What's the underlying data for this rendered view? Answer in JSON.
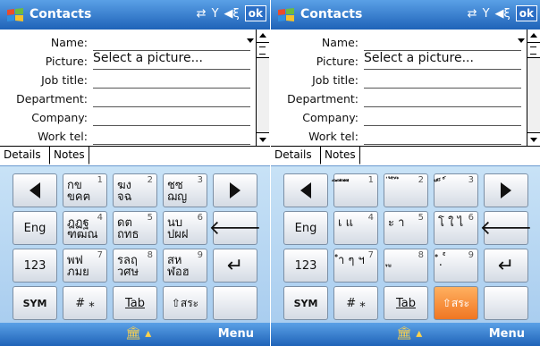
{
  "screens": [
    {
      "title": "Contacts",
      "ok_label": "ok",
      "fields": [
        {
          "label": "Name:",
          "value": "",
          "dropdown": true
        },
        {
          "label": "Picture:",
          "value": "Select a picture..."
        },
        {
          "label": "Job title:",
          "value": ""
        },
        {
          "label": "Department:",
          "value": ""
        },
        {
          "label": "Company:",
          "value": ""
        },
        {
          "label": "Work tel:",
          "value": ""
        }
      ],
      "tabs": [
        "Details",
        "Notes"
      ],
      "keys_row1": [
        {
          "glyph": "กข\nขคฅ",
          "num": "1"
        },
        {
          "glyph": "ฆง\nจฉ",
          "num": "2"
        },
        {
          "glyph": "ชซ\nฌญ",
          "num": "3"
        }
      ],
      "keys_row2": [
        {
          "glyph": "ฎฏฐ\nฑฒณ",
          "num": "4"
        },
        {
          "glyph": "ดต\nถทธ",
          "num": "5"
        },
        {
          "glyph": "นบ\nปผฝ",
          "num": "6"
        }
      ],
      "keys_row3": [
        {
          "glyph": "พฟ\nภมย",
          "num": "7"
        },
        {
          "glyph": "รลฤ\nวศษ",
          "num": "8"
        },
        {
          "glyph": "สห\nฬอฮ",
          "num": "9"
        }
      ],
      "key_eng": "Eng",
      "key_123": "123",
      "key_sym": "SYM",
      "key_hash": "# ⁎",
      "key_tab": "Tab",
      "key_shift": "⇧สระ",
      "menu_label": "Menu"
    },
    {
      "title": "Contacts",
      "ok_label": "ok",
      "fields": [
        {
          "label": "Name:",
          "value": "",
          "dropdown": true
        },
        {
          "label": "Picture:",
          "value": "Select a picture..."
        },
        {
          "label": "Job title:",
          "value": ""
        },
        {
          "label": "Department:",
          "value": ""
        },
        {
          "label": "Company:",
          "value": ""
        },
        {
          "label": "Work tel:",
          "value": ""
        }
      ],
      "tabs": [
        "Details",
        "Notes"
      ],
      "keys_row1": [
        {
          "glyph": "ิ ี ึ ื",
          "num": "1"
        },
        {
          "glyph": "่ ้ ๊ ๋",
          "num": "2"
        },
        {
          "glyph": "ั ็ ์",
          "num": "3"
        }
      ],
      "keys_row2": [
        {
          "glyph": "เ แ",
          "num": "4"
        },
        {
          "glyph": "ะ า",
          "num": "5"
        },
        {
          "glyph": "โ ใ ไ",
          "num": "6"
        }
      ],
      "keys_row3": [
        {
          "glyph": "ำ ๆ ฯ",
          "num": "7"
        },
        {
          "glyph": "ุ ู",
          "num": "8"
        },
        {
          "glyph": "ํ ฺ ๎",
          "num": "9"
        }
      ],
      "key_eng": "Eng",
      "key_123": "123",
      "key_sym": "SYM",
      "key_hash": "# ⁎",
      "key_tab": "Tab",
      "key_shift": "⇧สระ",
      "menu_label": "Menu"
    }
  ]
}
